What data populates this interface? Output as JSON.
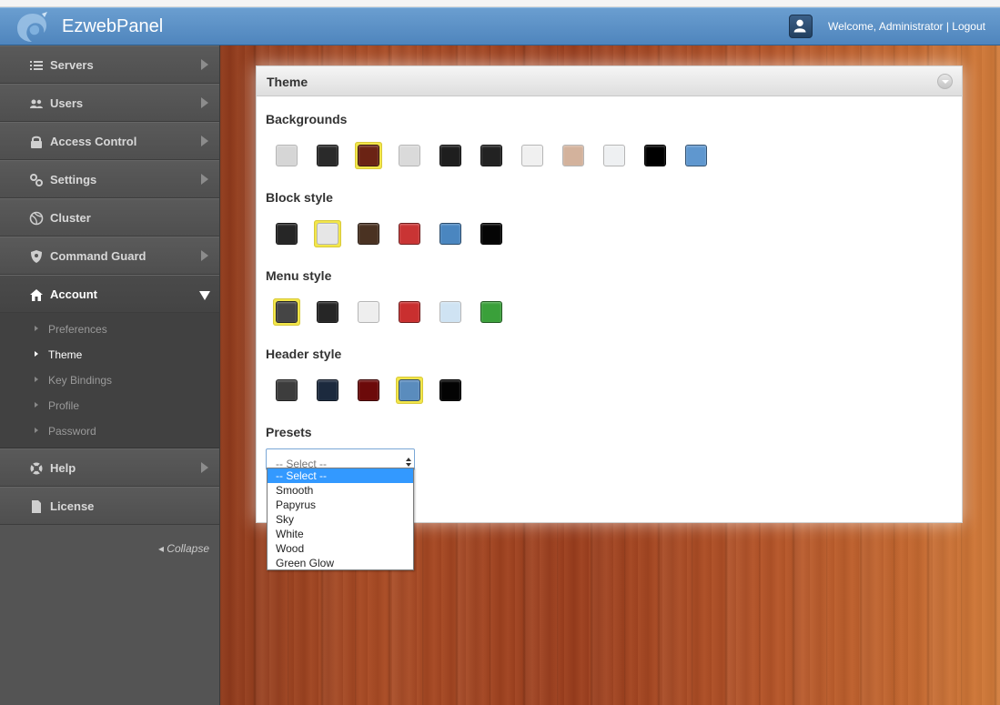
{
  "app": {
    "title": "EzwebPanel"
  },
  "user": {
    "welcome": "Welcome, Administrator | Logout"
  },
  "sidebar": {
    "items": [
      {
        "label": "Servers",
        "icon": "list-icon"
      },
      {
        "label": "Users",
        "icon": "users-icon"
      },
      {
        "label": "Access Control",
        "icon": "lock-icon"
      },
      {
        "label": "Settings",
        "icon": "gears-icon"
      },
      {
        "label": "Cluster",
        "icon": "globe-icon"
      },
      {
        "label": "Command Guard",
        "icon": "shield-icon"
      },
      {
        "label": "Account",
        "icon": "home-icon"
      },
      {
        "label": "Help",
        "icon": "lifebuoy-icon"
      },
      {
        "label": "License",
        "icon": "document-icon"
      }
    ],
    "account_submenu": [
      "Preferences",
      "Theme",
      "Key Bindings",
      "Profile",
      "Password"
    ],
    "collapse_label": "Collapse"
  },
  "panel": {
    "title": "Theme",
    "sections": {
      "backgrounds": {
        "title": "Backgrounds",
        "swatches": [
          "#d6d6d6",
          "#2a2a2a",
          "#6b2314",
          "#dadada",
          "#1e1e1e",
          "#222222",
          "#f0f0f0",
          "#d3b29c",
          "#eef0f2",
          "#000000",
          "#5f97cf"
        ],
        "selected_index": 2
      },
      "block_style": {
        "title": "Block style",
        "swatches": [
          "#262626",
          "#e6e6e6",
          "#4a3222",
          "#c93434",
          "#4a86c0",
          "#050505"
        ],
        "selected_index": 1
      },
      "menu_style": {
        "title": "Menu style",
        "swatches": [
          "#454545",
          "#262626",
          "#eeeeee",
          "#c92f2f",
          "#cfe3f3",
          "#3aa03a"
        ],
        "selected_index": 0
      },
      "header_style": {
        "title": "Header style",
        "swatches": [
          "#3d3d3d",
          "#1c2a3e",
          "#6c0a0a",
          "#5a8cbd",
          "#030303"
        ],
        "selected_index": 3
      }
    },
    "presets": {
      "title": "Presets",
      "selected": "-- Select --",
      "options": [
        "-- Select --",
        "Smooth",
        "Papyrus",
        "Sky",
        "White",
        "Wood",
        "Green Glow"
      ]
    }
  },
  "colors": {
    "header": "#5b91c7",
    "sidebar": "#545454",
    "selection": "#f2e64a",
    "highlight": "#3399ff"
  }
}
